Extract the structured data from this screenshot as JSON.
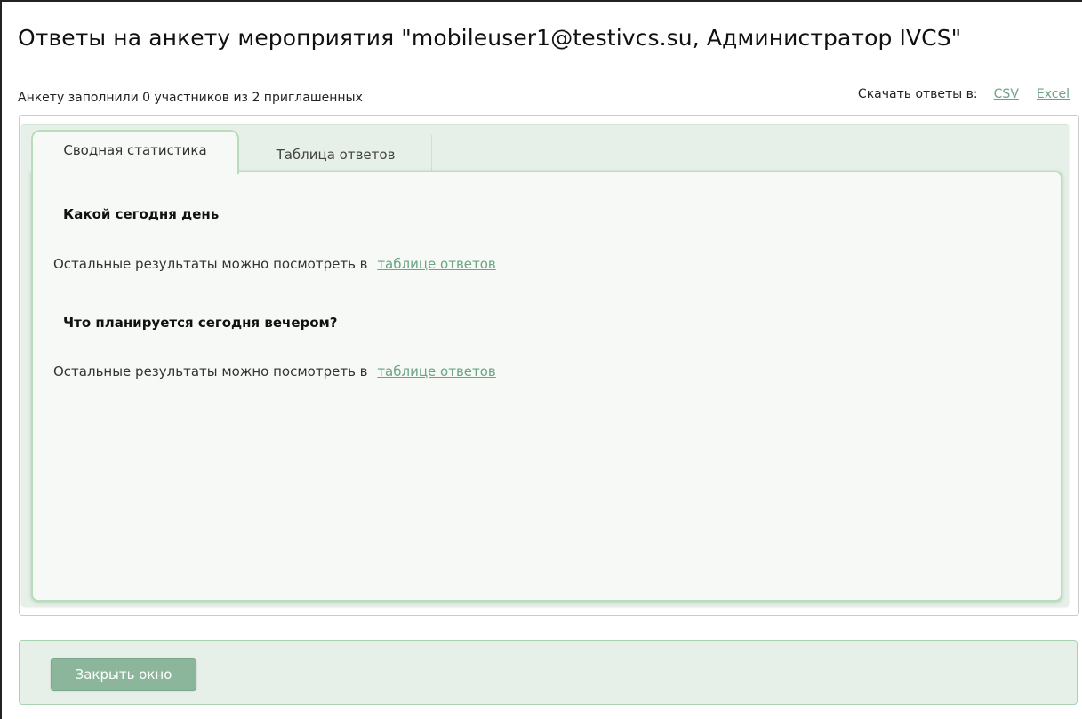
{
  "window": {
    "title": "Ответы на анкету мероприятия \"mobileuser1@testivcs.su, Администратор IVCS\"",
    "summary": "Анкету заполнили 0 участников из 2 приглашенных",
    "download": {
      "label": "Скачать ответы в:",
      "csv": "CSV",
      "excel": "Excel"
    }
  },
  "tabs": [
    {
      "label": "Сводная статистика",
      "active": true
    },
    {
      "label": "Таблица ответов",
      "active": false
    }
  ],
  "questions": [
    {
      "title": "Какой сегодня день",
      "rest_text": "Остальные результаты можно посмотреть в",
      "rest_link": "таблице ответов"
    },
    {
      "title": "Что планируется сегодня вечером?",
      "rest_text": "Остальные результаты можно посмотреть в",
      "rest_link": "таблице ответов"
    }
  ],
  "footer": {
    "close_label": "Закрыть окно"
  },
  "colors": {
    "accent_link": "#6aa485",
    "panel_bg": "#e6f0e8",
    "button_bg": "#8bb69c"
  }
}
